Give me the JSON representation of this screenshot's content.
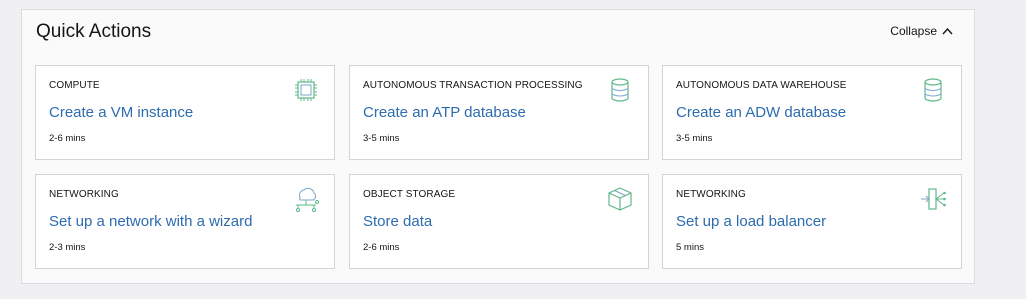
{
  "panel": {
    "title": "Quick Actions",
    "collapse_label": "Collapse"
  },
  "cards": [
    {
      "category": "COMPUTE",
      "title": "Create a VM instance",
      "time": "2-6 mins",
      "icon": "chip-icon"
    },
    {
      "category": "AUTONOMOUS TRANSACTION PROCESSING",
      "title": "Create an ATP database",
      "time": "3-5 mins",
      "icon": "database-icon"
    },
    {
      "category": "AUTONOMOUS DATA WAREHOUSE",
      "title": "Create an ADW database",
      "time": "3-5 mins",
      "icon": "database-icon"
    },
    {
      "category": "NETWORKING",
      "title": "Set up a network with a wizard",
      "time": "2-3 mins",
      "icon": "cloud-network-icon"
    },
    {
      "category": "OBJECT STORAGE",
      "title": "Store data",
      "time": "2-6 mins",
      "icon": "box-icon"
    },
    {
      "category": "NETWORKING",
      "title": "Set up a load balancer",
      "time": "5 mins",
      "icon": "load-balancer-icon"
    }
  ],
  "colors": {
    "link": "#2d6cae",
    "icon_green": "#5fb88a",
    "icon_blue": "#7aa7c7"
  }
}
